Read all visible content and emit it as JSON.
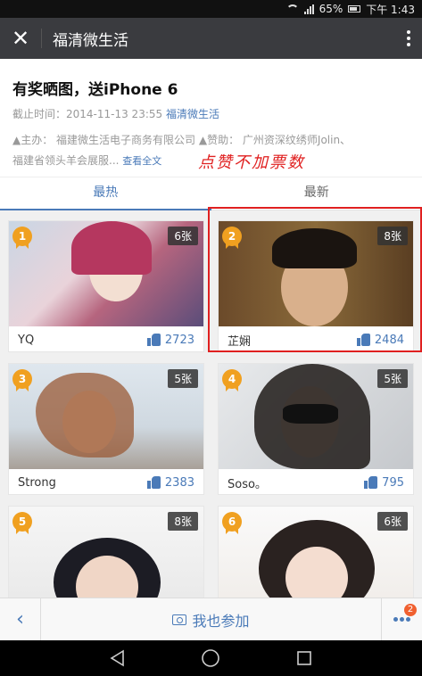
{
  "status_bar": {
    "battery": "65%",
    "time": "下午 1:43"
  },
  "titlebar": {
    "title": "福清微生活"
  },
  "header": {
    "title": "有奖晒图，送iPhone 6",
    "deadline_label": "截止时间：2014-11-13 23:55",
    "account": "福清微生活",
    "sponsors_line1": "▲主办：  福建微生活电子商务有限公司 ▲赞助：  广州资深纹绣师Jolin、",
    "sponsors_line2": "福建省领头羊会展服...",
    "read_more": "查看全文"
  },
  "annotation": "点赞不加票数",
  "tabs": [
    {
      "label": "最热"
    },
    {
      "label": "最新"
    }
  ],
  "cards": [
    {
      "rank": "1",
      "count": "6张",
      "name": "YQ",
      "likes": "2723"
    },
    {
      "rank": "2",
      "count": "8张",
      "name": "芷娴",
      "likes": "2484"
    },
    {
      "rank": "3",
      "count": "5张",
      "name": "Strong",
      "likes": "2383"
    },
    {
      "rank": "4",
      "count": "5张",
      "name": "Soso。",
      "likes": "795"
    },
    {
      "rank": "5",
      "count": "8张",
      "name": "",
      "likes": ""
    },
    {
      "rank": "6",
      "count": "6张",
      "name": "",
      "likes": ""
    }
  ],
  "bottombar": {
    "join_label": "我也参加",
    "notif_count": "2"
  },
  "colors": {
    "accent": "#4a7ab8",
    "highlight": "#e02020",
    "badge": "#f0a020"
  }
}
